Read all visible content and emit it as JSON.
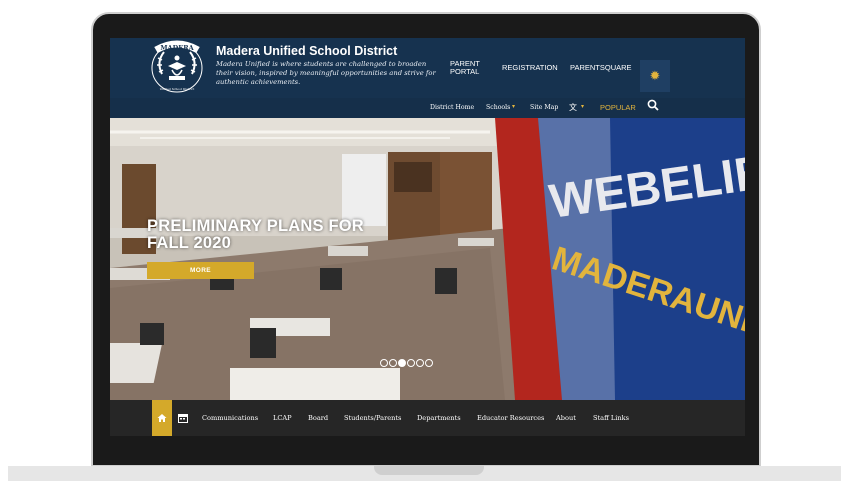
{
  "header": {
    "site_title": "Madera Unified School District",
    "tagline": "Madera Unified is where students are challenged to broaden their vision, inspired by meaningful opportunities and strive for authentic achievements.",
    "logo_text_top": "MADERA",
    "logo_text_bottom": "Unified School District",
    "nav": {
      "parent_portal_line1": "PARENT",
      "parent_portal_line2": "PORTAL",
      "registration": "REGISTRATION",
      "parentsquare": "PARENTSQUARE"
    },
    "settings_icon": "gear-icon"
  },
  "utility_bar": {
    "district_home": "District Home",
    "schools": "Schools",
    "site_map": "Site Map",
    "translate_icon": "translate-icon",
    "popular": "POPULAR",
    "search_icon": "search-icon"
  },
  "hero": {
    "title_line1": "PRELIMINARY PLANS FOR",
    "title_line2": "FALL 2020",
    "more_label": "MORE",
    "wall_text_1": "WEBELIEVE",
    "wall_text_2": "MADERAUNIFIED",
    "slide_count": 6,
    "active_slide": 3
  },
  "bottom_nav": {
    "home_icon": "home-icon",
    "calendar_icon": "calendar-icon",
    "items": [
      "Communications",
      "LCAP",
      "Board",
      "Students/Parents",
      "Departments",
      "Educator Resources",
      "About",
      "Staff Links"
    ]
  },
  "colors": {
    "header_bg": "#16324f",
    "accent_gold": "#d4a92a",
    "bottom_nav_bg": "#262626"
  }
}
